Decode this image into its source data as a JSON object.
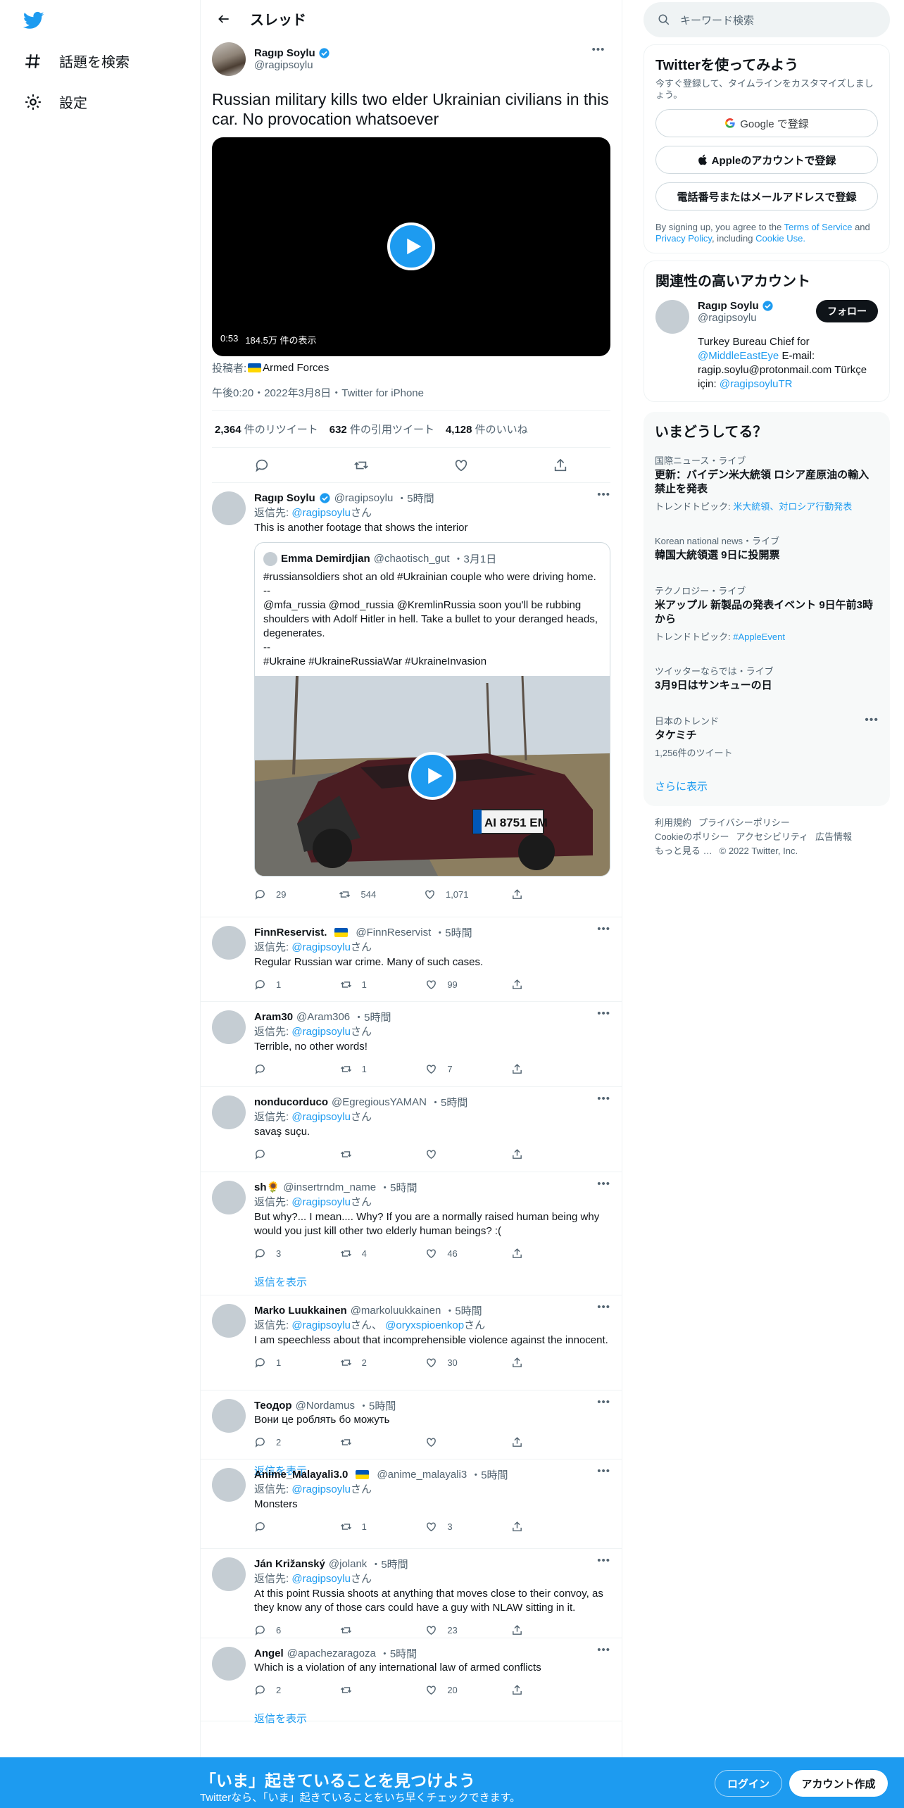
{
  "nav": {
    "items": [
      {
        "label": "話題を検索",
        "icon": "hashtag-icon"
      },
      {
        "label": "設定",
        "icon": "gear-icon"
      }
    ]
  },
  "header": {
    "title": "スレッド"
  },
  "main_tweet": {
    "author_name": "Ragıp Soylu",
    "handle": "@ragipsoylu",
    "text": "Russian military kills two elder Ukrainian civilians in this car. No provocation whatsoever",
    "video_duration": "0:53",
    "video_views": "184.5万 件の表示",
    "source_label": "投稿者:",
    "source_name": "Armed Forces",
    "timestamp": "午後0:20・2022年3月8日・Twitter for iPhone",
    "retweets": "2,364",
    "retweets_label": "件のリツイート",
    "quotes": "632",
    "quotes_label": "件の引用ツイート",
    "likes": "4,128",
    "likes_label": "件のいいね"
  },
  "replies": [
    {
      "name": "Ragıp Soylu",
      "handle": "@ragipsoylu",
      "time": "・5時間",
      "reply_label": "返信先:",
      "reply_to": "@ragipsoylu",
      "reply_suffix": "さん",
      "text": "This is another footage that shows the interior",
      "replies": "29",
      "retweets": "544",
      "likes": "1,071",
      "quote": {
        "name": "Emma Demirdjian",
        "handle": "@chaotisch_gut",
        "time": "・3月1日",
        "text": "#russiansoldiers shot an old #Ukrainian couple who were driving home.\n--\n@mfa_russia @mod_russia @KremlinRussia soon you'll be rubbing shoulders with Adolf Hitler in hell. Take a bullet to your deranged heads, degenerates.\n--\n#Ukraine #UkraineRussiaWar #UkraineInvasion",
        "plate": "AI 8751 EM"
      }
    },
    {
      "name": "FinnReservist.",
      "handle": "@FinnReservist",
      "time": "・5時間",
      "reply_label": "返信先:",
      "reply_to": "@ragipsoylu",
      "reply_suffix": "さん",
      "text": "Regular Russian war crime. Many of such cases.",
      "replies": "1",
      "retweets": "1",
      "likes": "99"
    },
    {
      "name": "Aram30",
      "handle": "@Aram306",
      "time": "・5時間",
      "reply_label": "返信先:",
      "reply_to": "@ragipsoylu",
      "reply_suffix": "さん",
      "text": "Terrible, no other words!",
      "replies": "",
      "retweets": "1",
      "likes": "7"
    },
    {
      "name": "nonducorduco",
      "handle": "@EgregiousYAMAN",
      "time": "・5時間",
      "reply_label": "返信先:",
      "reply_to": "@ragipsoylu",
      "reply_suffix": "さん",
      "text": "savaş suçu.",
      "replies": "",
      "retweets": "",
      "likes": ""
    },
    {
      "name": "sh🌻",
      "handle": "@insertrndm_name",
      "time": "・5時間",
      "reply_label": "返信先:",
      "reply_to": "@ragipsoylu",
      "reply_suffix": "さん",
      "text": "But why?... I mean.... Why?  If you are a normally raised human being why would you just kill other two elderly human beings? :(",
      "replies": "3",
      "retweets": "4",
      "likes": "46",
      "show_more": "返信を表示"
    },
    {
      "name": "Marko Luukkainen",
      "handle": "@markoluukkainen",
      "time": "・5時間",
      "reply_label": "返信先:",
      "reply_to": "@ragipsoylu",
      "reply_suffix": "さん、",
      "reply_to2": "@oryxspioenkop",
      "reply_suffix2": "さん",
      "text": "I am speechless about that incomprehensible violence against the innocent.",
      "replies": "1",
      "retweets": "2",
      "likes": "30"
    },
    {
      "name": "Теодор",
      "handle": "@Nordamus",
      "time": "・5時間",
      "text": "Вони це роблять бо можуть",
      "replies": "2",
      "retweets": "",
      "likes": "",
      "show_more": "返信を表示"
    },
    {
      "name": "Anime_Malayali3.0",
      "handle": "@anime_malayali3",
      "time": "・5時間",
      "reply_label": "返信先:",
      "reply_to": "@ragipsoylu",
      "reply_suffix": "さん",
      "text": "Monsters",
      "replies": "",
      "retweets": "1",
      "likes": "3"
    },
    {
      "name": "Ján Križanský",
      "handle": "@jolank",
      "time": "・5時間",
      "reply_label": "返信先:",
      "reply_to": "@ragipsoylu",
      "reply_suffix": "さん",
      "text": "At this point Russia shoots at anything that moves close to their convoy, as they know any of those cars could have a guy with NLAW sitting in it.",
      "replies": "6",
      "retweets": "",
      "likes": "23"
    },
    {
      "name": "Angel",
      "handle": "@apachezaragoza",
      "time": "・5時間",
      "text": "Which is a violation of any international law of armed conflicts",
      "replies": "2",
      "retweets": "",
      "likes": "20",
      "show_more": "返信を表示"
    }
  ],
  "search": {
    "placeholder": "キーワード検索"
  },
  "signup": {
    "title": "Twitterを使ってみよう",
    "subtitle": "今すぐ登録して、タイムラインをカスタマイズしましょう。",
    "google": "Google で登録",
    "apple": "Appleのアカウントで登録",
    "phone": "電話番号またはメールアドレスで登録",
    "legal_pre": "By signing up, you agree to the",
    "terms": "Terms of Service",
    "and": "and",
    "privacy": "Privacy Policy",
    "including": ", including",
    "cookie": "Cookie Use."
  },
  "relevant": {
    "title": "関連性の高いアカウント",
    "name": "Ragıp Soylu",
    "handle": "@ragipsoylu",
    "follow": "フォロー",
    "bio1": "Turkey Bureau Chief for",
    "bio_link1": "@MiddleEastEye",
    "bio2": "E-mail: ragip.soylu@protonmail.com Türkçe için:",
    "bio_link2": "@ragipsoyluTR"
  },
  "trends": {
    "title": "いまどうしてる？",
    "items": [
      {
        "context": "国際ニュース・ライブ",
        "title": "更新：バイデン米大統領 ロシア産原油の輸入禁止を発表",
        "topic_label": "トレンドトピック:",
        "topic": "米大統領、対ロシア行動発表"
      },
      {
        "context": "Korean national news・ライブ",
        "title": "韓国大統領選 9日に投開票"
      },
      {
        "context": "テクノロジー・ライブ",
        "title": "米アップル 新製品の発表イベント 9日午前3時から",
        "topic_label": "トレンドトピック:",
        "topic": "#AppleEvent"
      },
      {
        "context": "ツイッターならでは・ライブ",
        "title": "3月9日はサンキューの日"
      },
      {
        "context": "日本のトレンド",
        "title": "タケミチ",
        "count": "1,256件のツイート"
      }
    ],
    "show_more": "さらに表示"
  },
  "footer": {
    "links": [
      "利用規約",
      "プライバシーポリシー",
      "Cookieのポリシー",
      "アクセシビリティ",
      "広告情報",
      "もっと見る …",
      "© 2022 Twitter, Inc."
    ]
  },
  "bottom_bar": {
    "title": "「いま」起きていることを見つけよう",
    "subtitle": "Twitterなら、「いま」起きていることをいち早くチェックできます。",
    "login": "ログイン",
    "signup": "アカウント作成"
  },
  "colors": {
    "accent": "#1d9bf0",
    "text": "#0f1419",
    "secondary": "#536471"
  }
}
